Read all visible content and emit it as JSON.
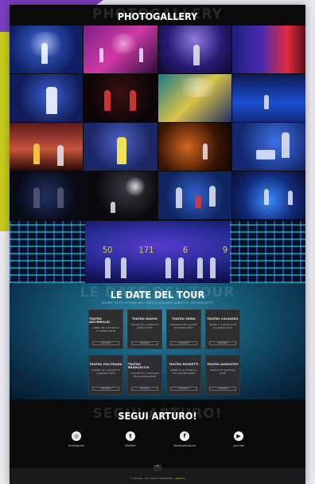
{
  "gallery": {
    "title": "PHOTOGALLERY",
    "ghost_title": "PHOTOGALLERY"
  },
  "stats": {
    "values": [
      "50",
      "171",
      "6",
      "9"
    ]
  },
  "tour": {
    "title": "LE DATE DEL TOUR",
    "ghost_title": "LE DATE DEL TOUR",
    "subtitle": "SCOPRI TUTTE LE DATE DEL TOUR E ACQUISTA SUBITO IL TUO BIGLIETTO",
    "cards": [
      {
        "city": "TEATRO ARCIMBOLDI",
        "date": "sabato 16 e domenica 17 ottobre 2015",
        "button": "ACQUISTA"
      },
      {
        "city": "TEATRO NUOVO",
        "date": "venerdì 22 e sabato 23 ottobre 2015",
        "button": "ACQUISTA"
      },
      {
        "city": "TEATRO VERDI",
        "date": "mercoledì 28 e giovedì 29 ottobre 2015",
        "button": "ACQUISTA"
      },
      {
        "city": "TEATRO COLOSSEO",
        "date": "sabato 7 e domenica 8 novembre 2015",
        "button": "ACQUISTA"
      },
      {
        "city": "TEATRO POLITEAMA",
        "date": "giovedì 12 e venerdì 13 novembre 2015",
        "button": "ACQUISTA"
      },
      {
        "city": "TEATRO BRANCACCIO",
        "date": "martedì 17 e mercoledì 18 novembre 2015",
        "button": "ACQUISTA"
      },
      {
        "city": "TEATRO ROSSETTI",
        "date": "sabato 21 e domenica 22 novembre 2015",
        "button": "ACQUISTA"
      },
      {
        "city": "TEATRO AUGUSTEO",
        "date": "venerdì 27 novembre 2015",
        "button": "ACQUISTA"
      }
    ]
  },
  "social": {
    "title": "SEGUI ARTURO!",
    "ghost_title": "SEGUI ARTURO!",
    "items": [
      {
        "label": "#instagram",
        "icon": "instagram-icon",
        "glyph": "◎"
      },
      {
        "label": "#twitter",
        "icon": "twitter-icon",
        "glyph": "t"
      },
      {
        "label": "/facebook/arturo",
        "icon": "facebook-icon",
        "glyph": "f"
      },
      {
        "label": "youtube",
        "icon": "youtube-icon",
        "glyph": "▶"
      }
    ]
  },
  "footer": {
    "to_top": "^",
    "copyright": "© ARTURO - ALL RIGHTS RESERVED - ",
    "link": "CREDITS"
  },
  "colors": {
    "accent_yellow": "#c8cc1e",
    "accent_purple": "#7c3fc1",
    "stat_yellow": "#d8d23a",
    "card_bg": "#2e2e31"
  }
}
